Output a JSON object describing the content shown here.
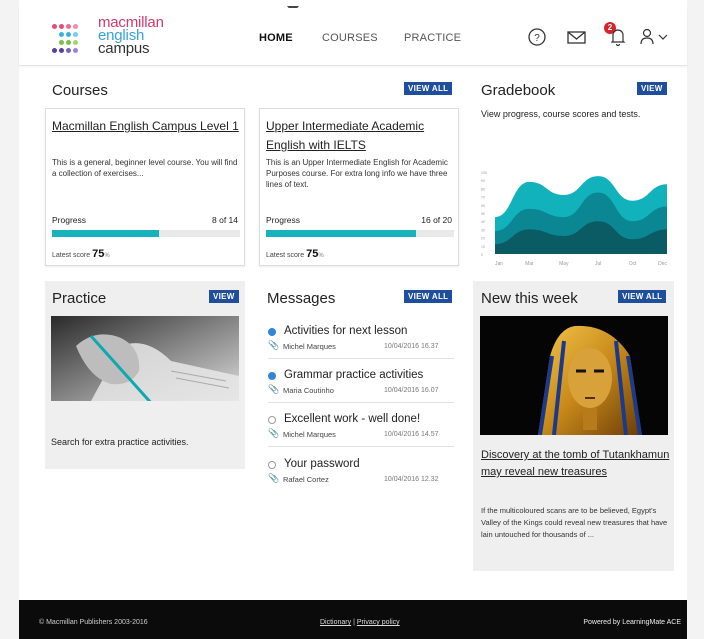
{
  "header": {
    "logo": {
      "line1": "macmillan",
      "line2": "english",
      "line3": "campus"
    },
    "nav": {
      "home": "HOME",
      "courses": "COURSES",
      "practice": "PRACTICE"
    },
    "notifications_count": "2",
    "icons": [
      "help-icon",
      "mail-icon",
      "bell-icon",
      "user-icon",
      "chevron-down-icon"
    ]
  },
  "courses": {
    "title": "Courses",
    "view_all": "VIEW ALL",
    "items": [
      {
        "title": "Macmillan English Campus Level 1",
        "description": "This is a general, beginner level course. You will find a collection of exercises...",
        "progress_label": "Progress",
        "progress_text": "8 of 14",
        "progress": 0.57,
        "latest_label": "Latest score",
        "latest_score": "75",
        "latest_unit": "%"
      },
      {
        "title": "Upper Intermediate Academic English with IELTS",
        "description": "This is an Upper Intermediate English for Academic Purposes course. For extra long info we have three lines of text.",
        "progress_label": "Progress",
        "progress_text": "16 of 20",
        "progress": 0.8,
        "latest_label": "Latest score",
        "latest_score": "75",
        "latest_unit": "%"
      }
    ]
  },
  "gradebook": {
    "title": "Gradebook",
    "view": "VIEW",
    "description": "View progress, course scores and tests.",
    "chart_data": {
      "type": "area",
      "x": [
        "Jan",
        "Mar",
        "May",
        "Jul",
        "Oct",
        "Dec"
      ],
      "y_ticks": [
        "100",
        "90",
        "80",
        "70",
        "60",
        "50",
        "40",
        "30",
        "20",
        "10",
        "0"
      ],
      "ylim": [
        0,
        100
      ],
      "series": [
        {
          "values": [
            45,
            88,
            72,
            95,
            65,
            85
          ]
        },
        {
          "values": [
            28,
            55,
            45,
            75,
            40,
            58
          ]
        },
        {
          "values": [
            12,
            30,
            22,
            40,
            18,
            30
          ]
        }
      ],
      "colors": [
        "#12b2bd",
        "#0b8793",
        "#0a5b64"
      ]
    }
  },
  "practice": {
    "title": "Practice",
    "view": "VIEW",
    "description": "Search for extra practice activities."
  },
  "messages": {
    "title": "Messages",
    "view_all": "VIEW ALL",
    "items": [
      {
        "subject": "Activities for next lesson",
        "from": "Michel Marques",
        "date": "10/04/2016 16.37",
        "unread": true
      },
      {
        "subject": "Grammar practice activities",
        "from": "Maria Coutinho",
        "date": "10/04/2016 16.07",
        "unread": true
      },
      {
        "subject": "Excellent work - well done!",
        "from": "Michel Marques",
        "date": "10/04/2016 14.57",
        "unread": false
      },
      {
        "subject": "Your password",
        "from": "Rafael Cortez",
        "date": "10/04/2016 12.32",
        "unread": false
      }
    ]
  },
  "news": {
    "title": "New this week",
    "view_all": "VIEW ALL",
    "headline": "Discovery at the tomb of Tutankhamun may reveal new treasures",
    "body": "If the multicoloured scans are to be believed, Egypt's Valley of the Kings could reveal new treasures that have lain untouched for thousands of ..."
  },
  "footer": {
    "copyright": "© Macmillan Publishers 2003-2016",
    "dictionary": "Dictionary",
    "separator": " | ",
    "privacy": "Privacy policy",
    "powered": "Powered by LearningMate ACE"
  }
}
